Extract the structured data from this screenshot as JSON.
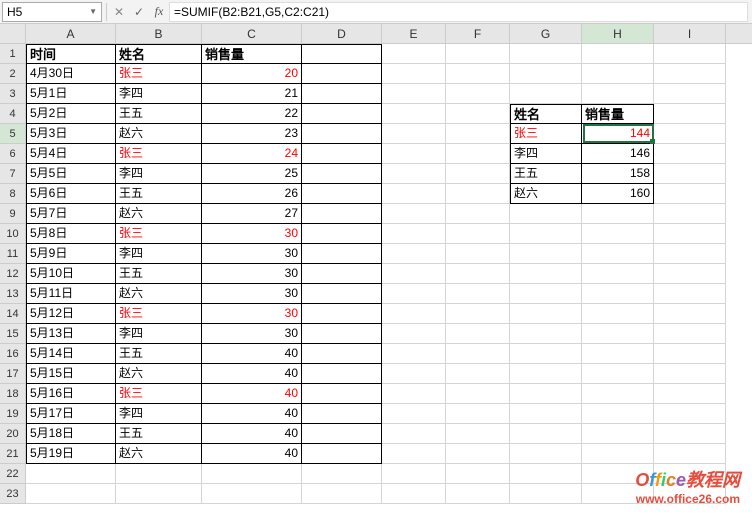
{
  "nameBox": "H5",
  "formula": "=SUMIF(B2:B21,G5,C2:C21)",
  "columns": [
    "A",
    "B",
    "C",
    "D",
    "E",
    "F",
    "G",
    "H",
    "I"
  ],
  "activeCol": "H",
  "activeRow": 5,
  "headers": {
    "A": "时间",
    "B": "姓名",
    "C": "销售量"
  },
  "table1": [
    {
      "date": "4月30日",
      "name": "张三",
      "val": 20,
      "red": true
    },
    {
      "date": "5月1日",
      "name": "李四",
      "val": 21
    },
    {
      "date": "5月2日",
      "name": "王五",
      "val": 22
    },
    {
      "date": "5月3日",
      "name": "赵六",
      "val": 23
    },
    {
      "date": "5月4日",
      "name": "张三",
      "val": 24,
      "red": true
    },
    {
      "date": "5月5日",
      "name": "李四",
      "val": 25
    },
    {
      "date": "5月6日",
      "name": "王五",
      "val": 26
    },
    {
      "date": "5月7日",
      "name": "赵六",
      "val": 27
    },
    {
      "date": "5月8日",
      "name": "张三",
      "val": 30,
      "red": true
    },
    {
      "date": "5月9日",
      "name": "李四",
      "val": 30
    },
    {
      "date": "5月10日",
      "name": "王五",
      "val": 30
    },
    {
      "date": "5月11日",
      "name": "赵六",
      "val": 30
    },
    {
      "date": "5月12日",
      "name": "张三",
      "val": 30,
      "red": true
    },
    {
      "date": "5月13日",
      "name": "李四",
      "val": 30
    },
    {
      "date": "5月14日",
      "name": "王五",
      "val": 40
    },
    {
      "date": "5月15日",
      "name": "赵六",
      "val": 40
    },
    {
      "date": "5月16日",
      "name": "张三",
      "val": 40,
      "red": true
    },
    {
      "date": "5月17日",
      "name": "李四",
      "val": 40
    },
    {
      "date": "5月18日",
      "name": "王五",
      "val": 40
    },
    {
      "date": "5月19日",
      "name": "赵六",
      "val": 40
    }
  ],
  "table2_headers": {
    "G": "姓名",
    "H": "销售量"
  },
  "table2": [
    {
      "name": "张三",
      "val": 144,
      "red": true
    },
    {
      "name": "李四",
      "val": 146
    },
    {
      "name": "王五",
      "val": 158
    },
    {
      "name": "赵六",
      "val": 160
    }
  ],
  "watermark": {
    "brand": "Office",
    "suffix": "教程网",
    "url": "www.office26.com"
  }
}
